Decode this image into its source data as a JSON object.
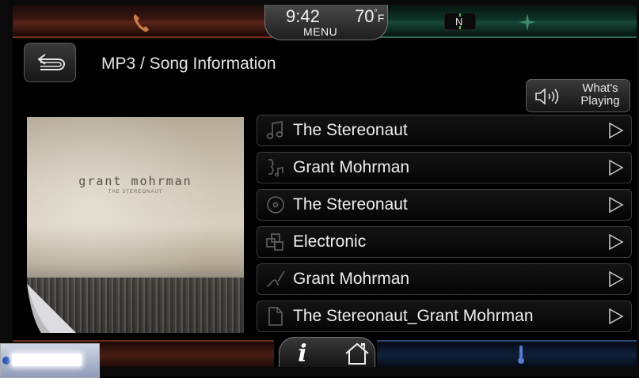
{
  "status": {
    "time": "9:42",
    "temperature": "70",
    "temperature_unit": "F",
    "menu_label": "MENU",
    "compass_heading": "N"
  },
  "header": {
    "title": "MP3 / Song Information",
    "whats_playing_line1": "What's",
    "whats_playing_line2": "Playing"
  },
  "album": {
    "artist_text": "grant mohrman",
    "subtitle_text": "THE STEREONAUT"
  },
  "info_rows": [
    {
      "icon": "music-note-icon",
      "label": "The Stereonaut"
    },
    {
      "icon": "artist-icon",
      "label": "Grant Mohrman"
    },
    {
      "icon": "album-disc-icon",
      "label": "The Stereonaut"
    },
    {
      "icon": "genre-icon",
      "label": "Electronic"
    },
    {
      "icon": "composer-icon",
      "label": "Grant Mohrman"
    },
    {
      "icon": "file-icon",
      "label": "The Stereonaut_Grant Mohrman"
    }
  ],
  "colors": {
    "phone_accent": "#c97a4a",
    "nav_accent": "#3a8a6a",
    "climate_accent": "#5a7ac8"
  }
}
